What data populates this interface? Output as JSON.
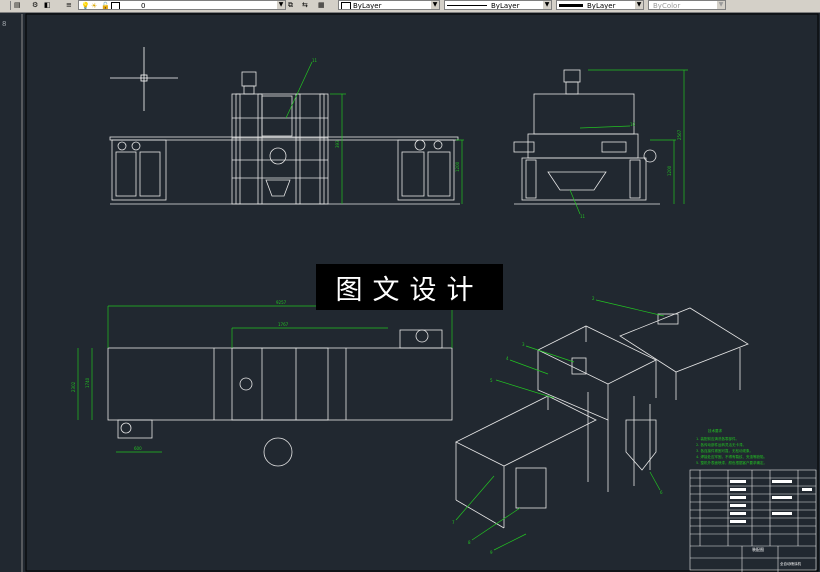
{
  "toolbar": {
    "layer_value": "0",
    "color_combo": "ByLayer",
    "linetype_combo": "ByLayer",
    "lineweight_combo": "ByLayer",
    "plotstyle_combo": "ByColor",
    "icons": [
      "layer-settings-icon",
      "layer-state-icon",
      "lightbulb-icon",
      "sun-icon",
      "lock-icon",
      "color-square-icon",
      "match-layer-icon",
      "previous-layer-icon"
    ]
  },
  "left_marker": "8",
  "banner": {
    "text": "图文设计"
  },
  "drawing": {
    "front_view": {
      "dims": [
        "393",
        "1200"
      ],
      "callout": "11"
    },
    "side_view": {
      "dims": [
        "2567",
        "1200"
      ],
      "callouts": [
        "10",
        "11"
      ]
    },
    "top_view": {
      "dims": [
        "9257",
        "1767",
        "1740",
        "2302",
        "600"
      ]
    },
    "iso_callouts": [
      "2",
      "3",
      "4",
      "5",
      "6",
      "7",
      "8",
      "9",
      "1"
    ],
    "notes": {
      "title": "技术要求",
      "lines": [
        "1. 装配前应清洗各零部件。",
        "2. 各传动部件运转灵活无卡滞。",
        "3. 各连接件紧固可靠，无松动现象。",
        "4. 焊接处应牢固，不得有裂纹、夹渣等缺陷。",
        "5. 整机外表面喷漆，颜色根据客户要求确定。"
      ]
    },
    "title_block": {
      "drawing_name": "装配图",
      "company": "全自动喷涂机"
    }
  }
}
